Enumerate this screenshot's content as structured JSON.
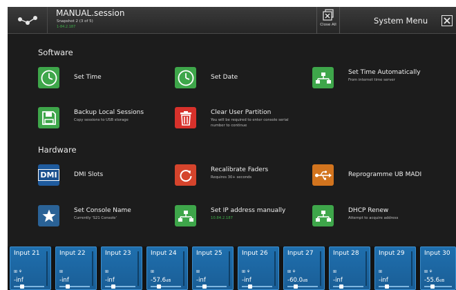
{
  "header": {
    "session_title": "MANUAL.session",
    "snapshot": "Snapshot 2 (3 of 5)",
    "snapshot_sub": "1-84.2.187",
    "close_all_label": "Close All",
    "system_menu_title": "System Menu"
  },
  "software": {
    "title": "Software",
    "set_time": "Set Time",
    "set_date": "Set Date",
    "set_time_auto": "Set Time Automatically",
    "set_time_auto_sub": "From internet time server",
    "backup": "Backup Local Sessions",
    "backup_sub": "Copy sessions to USB storage",
    "clear_partition": "Clear User Partition",
    "clear_partition_sub1": "You will be required to enter console serial",
    "clear_partition_sub2": "number to continue"
  },
  "hardware": {
    "title": "Hardware",
    "dmi_slots": "DMI Slots",
    "dmi_icon_text": "DMI",
    "recalibrate": "Recalibrate Faders",
    "recalibrate_sub": "Requires 30+ seconds",
    "reprogramme": "Reprogramme UB MADI",
    "console_name": "Set Console Name",
    "console_name_sub": "Currently 'S21 Console'",
    "set_ip": "Set IP address manually",
    "set_ip_sub": "10.84.2.187",
    "dhcp": "DHCP Renew",
    "dhcp_sub": "Attempt to acquire address"
  },
  "strips": [
    {
      "name": "Input 21",
      "icons": "⊞ ⚘",
      "level": "-inf",
      "unit": ""
    },
    {
      "name": "Input 22",
      "icons": "⊞",
      "level": "-inf",
      "unit": ""
    },
    {
      "name": "Input 23",
      "icons": "⊞",
      "level": "-inf",
      "unit": ""
    },
    {
      "name": "Input 24",
      "icons": "⊞",
      "level": "-57.6",
      "unit": "dB"
    },
    {
      "name": "Input 25",
      "icons": "⊞",
      "level": "-inf",
      "unit": ""
    },
    {
      "name": "Input 26",
      "icons": "⊞ ⚘",
      "level": "-inf",
      "unit": ""
    },
    {
      "name": "Input 27",
      "icons": "⊞ ⚘",
      "level": "-60.0",
      "unit": "dB"
    },
    {
      "name": "Input 28",
      "icons": "⊞",
      "level": "-inf",
      "unit": ""
    },
    {
      "name": "Input 29",
      "icons": "⊞",
      "level": "-inf",
      "unit": ""
    },
    {
      "name": "Input 30",
      "icons": "⊞ ⚘",
      "level": "-55.6",
      "unit": "dB"
    }
  ],
  "colors": {
    "green_tile": "#3ea64a",
    "red_tile": "#d7312b",
    "blue_tile": "#1f5b9e",
    "orange_tile": "#d2741e",
    "strip_blue": "#1f6fae"
  }
}
